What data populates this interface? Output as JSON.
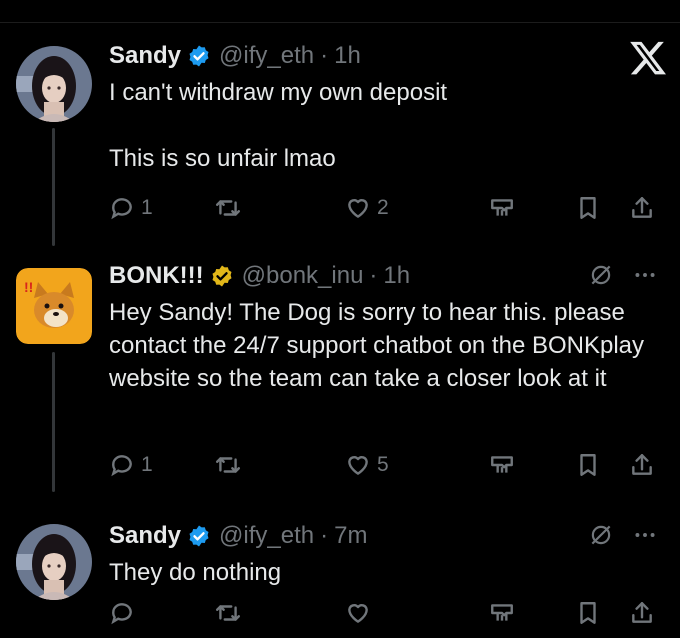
{
  "tweets": [
    {
      "name": "Sandy",
      "handle": "@ify_eth",
      "dot": "·",
      "time": "1h",
      "text": "I can't withdraw my own deposit\n\nThis is so unfair lmao",
      "replies": "1",
      "retweets": "",
      "likes": "2"
    },
    {
      "name": "BONK!!!",
      "handle": "@bonk_inu",
      "dot": "·",
      "time": "1h",
      "text": "Hey Sandy! The Dog is sorry to hear this. please contact the 24/7 support chatbot on the BONKplay website so the team can take a closer look at it",
      "replies": "1",
      "retweets": "",
      "likes": "5"
    },
    {
      "name": "Sandy",
      "handle": "@ify_eth",
      "dot": "·",
      "time": "7m",
      "text": "They do nothing",
      "replies": "",
      "retweets": "",
      "likes": ""
    }
  ],
  "colors": {
    "verified_blue": "#1d9bf0",
    "verified_gold": "#e2b719",
    "muted": "#71767b"
  },
  "icons": [
    "x-logo-icon",
    "verified-badge-icon",
    "reply-icon",
    "retweet-icon",
    "like-icon",
    "analytics-icon",
    "bookmark-icon",
    "share-icon",
    "grok-icon",
    "more-icon"
  ]
}
